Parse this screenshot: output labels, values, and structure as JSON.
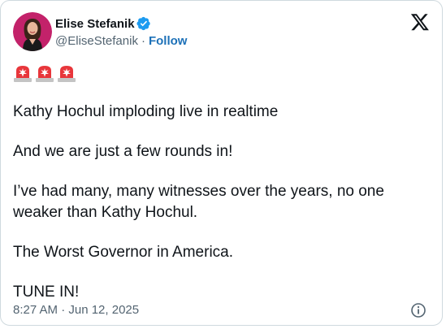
{
  "author": {
    "display_name": "Elise Stefanik",
    "handle": "@EliseStefanik",
    "separator": "·",
    "follow_label": "Follow"
  },
  "icons": {
    "verified": "verified-badge-icon",
    "platform": "x-logo-icon",
    "siren": "police-car-light-icon",
    "info": "info-icon"
  },
  "emoji_count": 3,
  "tweet": {
    "paragraphs": [
      "Kathy Hochul imploding live in realtime",
      "And we are just a few rounds in!",
      "I’ve had many, many witnesses over the years, no one weaker than Kathy Hochul.",
      "The Worst Governor in America.",
      "TUNE IN!"
    ]
  },
  "footer": {
    "timestamp": "8:27 AM · Jun 12, 2025"
  },
  "colors": {
    "verified_blue": "#1d9bf0",
    "follow_blue": "#1d71b8",
    "secondary_text": "#536471",
    "siren_red": "#e8363b"
  }
}
